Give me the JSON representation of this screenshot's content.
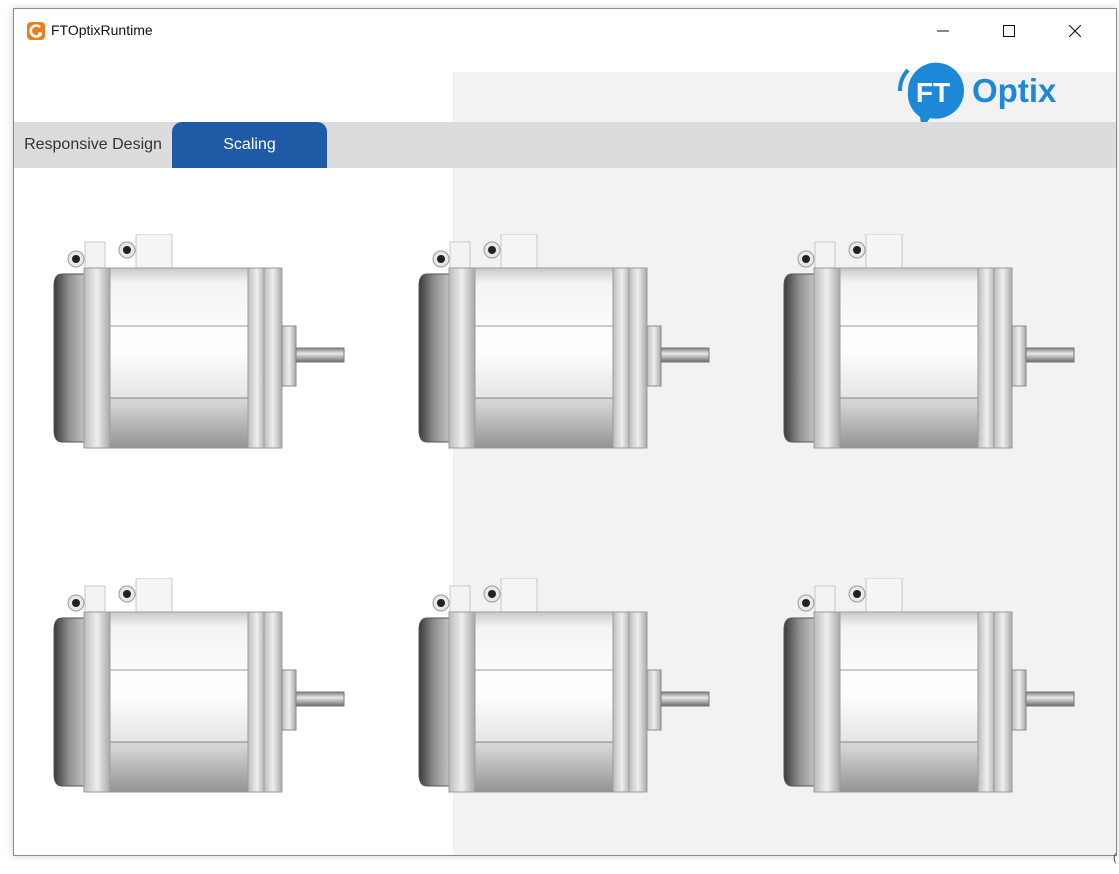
{
  "window": {
    "title": "FTOptixRuntime",
    "app_icon": "optix-runtime-icon",
    "controls": [
      "minimize-icon",
      "maximize-icon",
      "close-icon"
    ]
  },
  "logo": {
    "badge_text": "FT",
    "text": "Optix",
    "color": "#1e88d8"
  },
  "tabs": [
    {
      "label": "Responsive Design",
      "selected": false
    },
    {
      "label": "Scaling",
      "selected": true
    }
  ],
  "colors": {
    "tab_selected": "#1e5aa5",
    "tabbar": "#dcdcdc",
    "panel": "#f2f2f2"
  },
  "motors": [
    {
      "name": "motor-1"
    },
    {
      "name": "motor-2"
    },
    {
      "name": "motor-3"
    },
    {
      "name": "motor-4"
    },
    {
      "name": "motor-5"
    },
    {
      "name": "motor-6"
    }
  ],
  "corner_mark": "("
}
